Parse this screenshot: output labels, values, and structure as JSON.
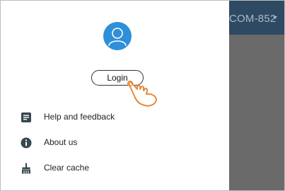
{
  "background_app": {
    "title_fragment": "COM-852"
  },
  "drawer": {
    "login_label": "Login",
    "menu": [
      {
        "label": "Help and feedback",
        "icon": "feedback-icon"
      },
      {
        "label": "About us",
        "icon": "info-icon"
      },
      {
        "label": "Clear cache",
        "icon": "broom-icon"
      }
    ]
  },
  "colors": {
    "avatar": "#2f8fd9",
    "appbar": "#2e4a63",
    "scrim": "#6a6a6a",
    "hand_stroke": "#e38a3a"
  }
}
